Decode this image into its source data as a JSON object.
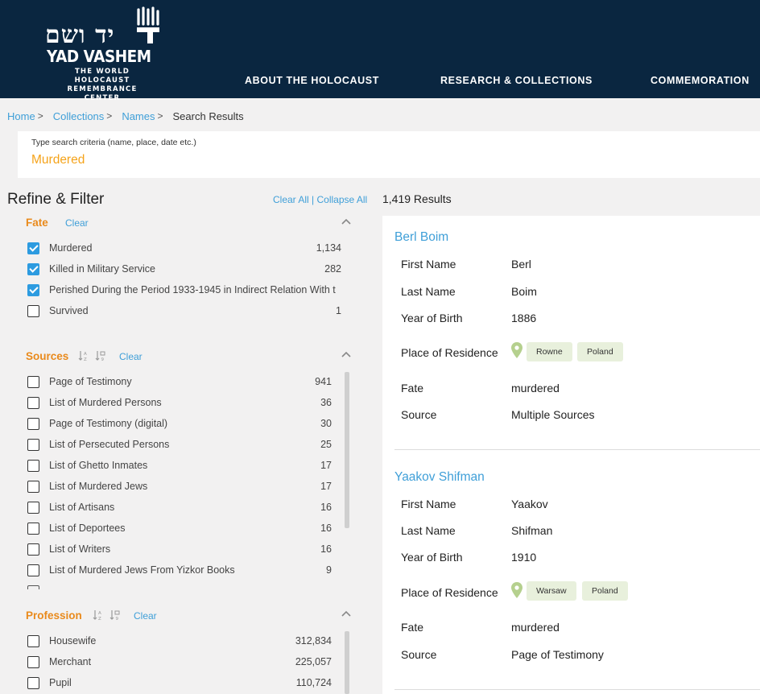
{
  "header": {
    "logo_hebrew": "יד ושם",
    "logo_main": "YAD VASHEM",
    "logo_sub_line1": "THE WORLD HOLOCAUST",
    "logo_sub_line2": "REMEMBRANCE CENTER",
    "nav": [
      "ABOUT THE HOLOCAUST",
      "RESEARCH & COLLECTIONS",
      "COMMEMORATION"
    ],
    "bg_color": "#0a2640"
  },
  "breadcrumb": {
    "items": [
      "Home",
      "Collections",
      "Names"
    ],
    "separator": ">",
    "current": "Search Results"
  },
  "search": {
    "label": "Type search criteria (name, place, date etc.)",
    "value": "Murdered"
  },
  "filters": {
    "title": "Refine & Filter",
    "clear_all": "Clear All",
    "separator": "|",
    "collapse_all": "Collapse All",
    "fate": {
      "title": "Fate",
      "clear": "Clear",
      "items": [
        {
          "label": "Murdered",
          "count": "1,134",
          "checked": true
        },
        {
          "label": "Killed in Military Service",
          "count": "282",
          "checked": true
        },
        {
          "label": "Perished During the Period 1933-1945 in Indirect Relation With t",
          "count": "",
          "checked": true
        },
        {
          "label": "Survived",
          "count": "1",
          "checked": false
        }
      ]
    },
    "sources": {
      "title": "Sources",
      "clear": "Clear",
      "items": [
        {
          "label": "Page of Testimony",
          "count": "941"
        },
        {
          "label": "List of Murdered Persons",
          "count": "36"
        },
        {
          "label": "Page of Testimony (digital)",
          "count": "30"
        },
        {
          "label": "List of Persecuted Persons",
          "count": "25"
        },
        {
          "label": "List of Ghetto Inmates",
          "count": "17"
        },
        {
          "label": "List of Murdered Jews",
          "count": "17"
        },
        {
          "label": "List of Artisans",
          "count": "16"
        },
        {
          "label": "List of Deportees",
          "count": "16"
        },
        {
          "label": "List of Writers",
          "count": "16"
        },
        {
          "label": "List of Murdered Jews From Yizkor Books",
          "count": "9"
        }
      ]
    },
    "profession": {
      "title": "Profession",
      "clear": "Clear",
      "items": [
        {
          "label": "Housewife",
          "count": "312,834"
        },
        {
          "label": "Merchant",
          "count": "225,057"
        },
        {
          "label": "Pupil",
          "count": "110,724"
        }
      ]
    }
  },
  "results": {
    "count_label": "1,419 Results",
    "field_labels": {
      "first_name": "First Name",
      "last_name": "Last Name",
      "year_of_birth": "Year of Birth",
      "place_of_residence": "Place of Residence",
      "fate": "Fate",
      "source": "Source"
    },
    "records": [
      {
        "name": "Berl Boim",
        "first_name": "Berl",
        "last_name": "Boim",
        "year_of_birth": "1886",
        "place_city": "Rowne",
        "place_country": "Poland",
        "fate": "murdered",
        "source": "Multiple Sources"
      },
      {
        "name": "Yaakov Shifman",
        "first_name": "Yaakov",
        "last_name": "Shifman",
        "year_of_birth": "1910",
        "place_city": "Warsaw",
        "place_country": "Poland",
        "fate": "murdered",
        "source": "Page of Testimony"
      }
    ]
  },
  "colors": {
    "accent_orange": "#e98a1c",
    "link_blue": "#3f9fd8",
    "checkbox_blue": "#2d9be0",
    "tag_green": "#e8f0dc",
    "pin_green": "#b5d08e"
  }
}
